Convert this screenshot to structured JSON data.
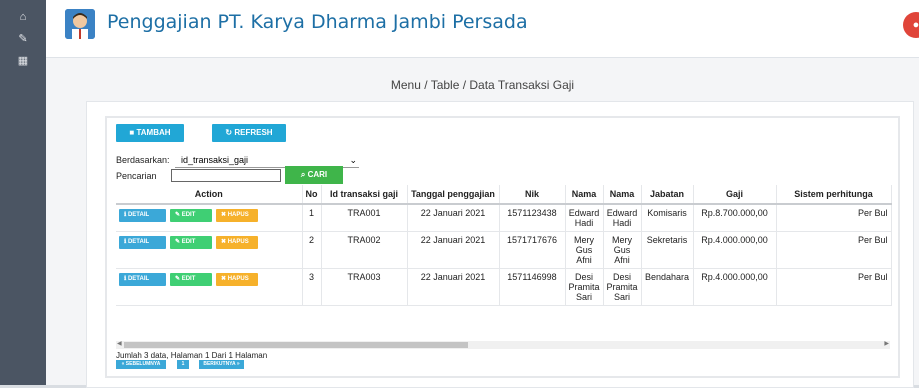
{
  "app": {
    "title": "Penggajian PT. Karya Dharma Jambi Persada"
  },
  "breadcrumb": "Menu / Table / Data Transaksi Gaji",
  "toolbar": {
    "add_label": "TAMBAH",
    "refresh_label": "REFRESH"
  },
  "filter": {
    "by_label": "Berdasarkan:",
    "selected": "id_transaksi_gaji",
    "search_label": "Pencarian",
    "search_value": "",
    "search_button": "CARI"
  },
  "table": {
    "headers": [
      "Action",
      "No",
      "Id transaksi gaji",
      "Tanggal penggajian",
      "Nik",
      "Nama",
      "Nama",
      "Jabatan",
      "Gaji",
      "Sistem perhitunga"
    ],
    "action_labels": {
      "detail": "DETAIL",
      "edit": "EDIT",
      "hapus": "HAPUS"
    },
    "rows": [
      {
        "no": "1",
        "id": "TRA001",
        "tanggal": "22 Januari 2021",
        "nik": "1571123438",
        "nama1": "Edward Hadi",
        "nama2": "Edward Hadi",
        "jabatan": "Komisaris",
        "gaji": "Rp.8.700.000,00",
        "sistem": "Per Bul"
      },
      {
        "no": "2",
        "id": "TRA002",
        "tanggal": "22 Januari 2021",
        "nik": "1571717676",
        "nama1": "Mery Gus Afni",
        "nama2": "Mery Gus Afni",
        "jabatan": "Sekretaris",
        "gaji": "Rp.4.000.000,00",
        "sistem": "Per Bul"
      },
      {
        "no": "3",
        "id": "TRA003",
        "tanggal": "22 Januari 2021",
        "nik": "1571146998",
        "nama1": "Desi Pramita Sari",
        "nama2": "Desi Pramita Sari",
        "jabatan": "Bendahara",
        "gaji": "Rp.4.000.000,00",
        "sistem": "Per Bul"
      }
    ]
  },
  "footer": {
    "summary": "Jumlah 3 data, Halaman 1 Dari 1 Halaman",
    "prev": "« SEBELUMNYA",
    "page": "1",
    "next": "BERIKUTNYA »"
  },
  "icons": {
    "home": "home-icon",
    "edit": "edit-icon",
    "calendar": "calendar-icon",
    "user": "user-icon"
  },
  "colors": {
    "primary": "#21a7d6",
    "success": "#3fb54a",
    "edit": "#3fcf74",
    "warning": "#f6b12b",
    "title": "#1d6fa5"
  }
}
